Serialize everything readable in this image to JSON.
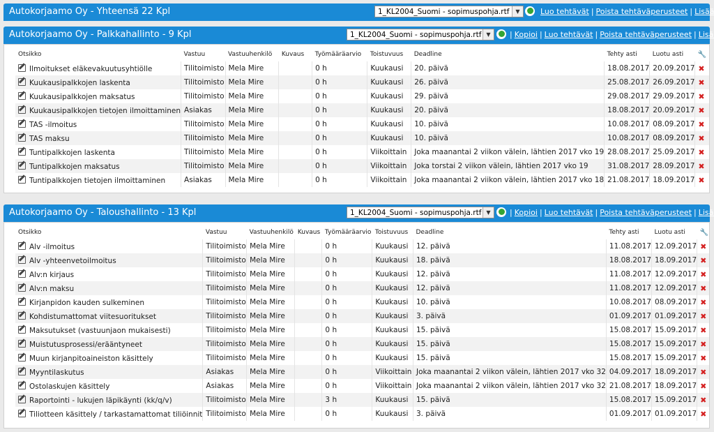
{
  "top": {
    "title": "Autokorjaamo Oy - Yhteensä 22 Kpl",
    "select_value": "1_KL2004_Suomi - sopimuspohja.rtf",
    "links": [
      "Luo tehtävät",
      "Poista tehtäväperusteet",
      "Lisää uusi"
    ]
  },
  "sections": [
    {
      "title": "Autokorjaamo Oy - Palkkahallinto - 9 Kpl",
      "select_value": "1_KL2004_Suomi - sopimuspohja.rtf",
      "links": [
        "Kopioi",
        "Luo tehtävät",
        "Poista tehtäväperusteet",
        "Lisää uusi"
      ],
      "columns": [
        "Otsikko",
        "Vastuu",
        "Vastuuhenkilö",
        "Kuvaus",
        "Työmääräarvio",
        "Toistuvuus",
        "Deadline",
        "Tehty asti",
        "Luotu asti"
      ],
      "rows": [
        [
          "Ilmoitukset eläkevakuutusyhtiölle",
          "Tilitoimisto",
          "Mela Mire",
          "",
          "0 h",
          "Kuukausi",
          "20. päivä",
          "18.08.2017",
          "20.09.2017"
        ],
        [
          "Kuukausipalkkojen laskenta",
          "Tilitoimisto",
          "Mela Mire",
          "",
          "0 h",
          "Kuukausi",
          "26. päivä",
          "25.08.2017",
          "26.09.2017"
        ],
        [
          "Kuukausipalkkojen maksatus",
          "Tilitoimisto",
          "Mela Mire",
          "",
          "0 h",
          "Kuukausi",
          "29. päivä",
          "29.08.2017",
          "29.09.2017"
        ],
        [
          "Kuukausipalkkojen tietojen ilmoittaminen",
          "Asiakas",
          "Mela Mire",
          "",
          "0 h",
          "Kuukausi",
          "20. päivä",
          "18.08.2017",
          "20.09.2017"
        ],
        [
          "TAS -ilmoitus",
          "Tilitoimisto",
          "Mela Mire",
          "",
          "0 h",
          "Kuukausi",
          "10. päivä",
          "10.08.2017",
          "08.09.2017"
        ],
        [
          "TAS maksu",
          "Tilitoimisto",
          "Mela Mire",
          "",
          "0 h",
          "Kuukausi",
          "10. päivä",
          "10.08.2017",
          "08.09.2017"
        ],
        [
          "Tuntipalkkojen laskenta",
          "Tilitoimisto",
          "Mela Mire",
          "",
          "0 h",
          "Viikoittain",
          "Joka maanantai 2 viikon välein, lähtien 2017 vko 19",
          "28.08.2017",
          "25.09.2017"
        ],
        [
          "Tuntipalkkojen maksatus",
          "Tilitoimisto",
          "Mela Mire",
          "",
          "0 h",
          "Viikoittain",
          "Joka torstai 2 viikon välein, lähtien 2017 vko 19",
          "31.08.2017",
          "28.09.2017"
        ],
        [
          "Tuntipalkkojen tietojen ilmoittaminen",
          "Asiakas",
          "Mela Mire",
          "",
          "0 h",
          "Viikoittain",
          "Joka maanantai 2 viikon välein, lähtien 2017 vko 18",
          "21.08.2017",
          "18.09.2017"
        ]
      ]
    },
    {
      "title": "Autokorjaamo Oy - Taloushallinto - 13 Kpl",
      "select_value": "1_KL2004_Suomi - sopimuspohja.rtf",
      "links": [
        "Kopioi",
        "Luo tehtävät",
        "Poista tehtäväperusteet",
        "Lisää uusi"
      ],
      "columns": [
        "Otsikko",
        "Vastuu",
        "Vastuuhenkilö",
        "Kuvaus",
        "Työmääräarvio",
        "Toistuvuus",
        "Deadline",
        "Tehty asti",
        "Luotu asti"
      ],
      "rows": [
        [
          "Alv -ilmoitus",
          "Tilitoimisto",
          "Mela Mire",
          "",
          "0 h",
          "Kuukausi",
          "12. päivä",
          "11.08.2017",
          "12.09.2017"
        ],
        [
          "Alv -yhteenvetoilmoitus",
          "Tilitoimisto",
          "Mela Mire",
          "",
          "0 h",
          "Kuukausi",
          "18. päivä",
          "18.08.2017",
          "18.09.2017"
        ],
        [
          "Alv:n kirjaus",
          "Tilitoimisto",
          "Mela Mire",
          "",
          "0 h",
          "Kuukausi",
          "12. päivä",
          "11.08.2017",
          "12.09.2017"
        ],
        [
          "Alv:n maksu",
          "Tilitoimisto",
          "Mela Mire",
          "",
          "0 h",
          "Kuukausi",
          "12. päivä",
          "11.08.2017",
          "12.09.2017"
        ],
        [
          "Kirjanpidon kauden sulkeminen",
          "Tilitoimisto",
          "Mela Mire",
          "",
          "0 h",
          "Kuukausi",
          "10. päivä",
          "10.08.2017",
          "08.09.2017"
        ],
        [
          "Kohdistumattomat viitesuoritukset",
          "Tilitoimisto",
          "Mela Mire",
          "",
          "0 h",
          "Kuukausi",
          "3. päivä",
          "01.09.2017",
          "01.09.2017"
        ],
        [
          "Maksutukset (vastuunjaon mukaisesti)",
          "Tilitoimisto",
          "Mela Mire",
          "",
          "0 h",
          "Kuukausi",
          "15. päivä",
          "15.08.2017",
          "15.09.2017"
        ],
        [
          "Muistutusprosessi/erääntyneet",
          "Tilitoimisto",
          "Mela Mire",
          "",
          "0 h",
          "Kuukausi",
          "15. päivä",
          "15.08.2017",
          "15.09.2017"
        ],
        [
          "Muun kirjanpitoaineiston käsittely",
          "Tilitoimisto",
          "Mela Mire",
          "",
          "0 h",
          "Kuukausi",
          "15. päivä",
          "15.08.2017",
          "15.09.2017"
        ],
        [
          "Myyntilaskutus",
          "Asiakas",
          "Mela Mire",
          "",
          "0 h",
          "Viikoittain",
          "Joka maanantai 2 viikon välein, lähtien 2017 vko 32",
          "04.09.2017",
          "18.09.2017"
        ],
        [
          "Ostolaskujen käsittely",
          "Asiakas",
          "Mela Mire",
          "",
          "0 h",
          "Viikoittain",
          "Joka maanantai 2 viikon välein, lähtien 2017 vko 32",
          "21.08.2017",
          "18.09.2017"
        ],
        [
          "Raportointi - lukujen läpikäynti (kk/q/v)",
          "Tilitoimisto",
          "Mela Mire",
          "",
          "3 h",
          "Kuukausi",
          "15. päivä",
          "15.08.2017",
          "15.09.2017"
        ],
        [
          "Tiliotteen käsittely / tarkastamattomat tiliöinnit",
          "Tilitoimisto",
          "Mela Mire",
          "",
          "0 h",
          "Kuukausi",
          "3. päivä",
          "01.09.2017",
          "01.09.2017"
        ]
      ]
    }
  ],
  "icons": {
    "edit": "edit-icon",
    "delete": "delete-icon",
    "settings": "wrench-icon",
    "go": "go-arrow-icon",
    "delete_glyph": "✖",
    "settings_glyph": "🔧"
  },
  "colors": {
    "header_bar": "#1a8ad6",
    "delete": "#d42020",
    "row_alt": "#f2f2f2"
  }
}
